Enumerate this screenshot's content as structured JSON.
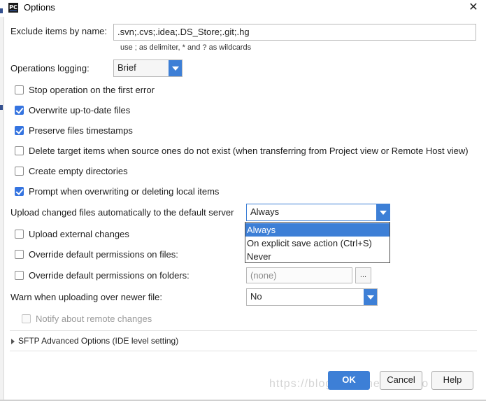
{
  "window": {
    "title": "Options",
    "app_icon_text": "PC"
  },
  "exclude": {
    "label": "Exclude items by name:",
    "value": ".svn;.cvs;.idea;.DS_Store;.git;.hg",
    "hint": "use ; as delimiter, * and ? as wildcards"
  },
  "logging": {
    "label": "Operations logging:",
    "value": "Brief"
  },
  "checkboxes": [
    {
      "label": "Stop operation on the first error",
      "checked": false
    },
    {
      "label": "Overwrite up-to-date files",
      "checked": true
    },
    {
      "label": "Preserve files timestamps",
      "checked": true
    },
    {
      "label": "Delete target items when source ones do not exist (when transferring from Project view or Remote Host view)",
      "checked": false
    },
    {
      "label": "Create empty directories",
      "checked": false
    },
    {
      "label": "Prompt when overwriting or deleting local items",
      "checked": true
    }
  ],
  "upload_auto": {
    "label": "Upload changed files automatically to the default server",
    "value": "Always",
    "options": [
      "Always",
      "On explicit save action (Ctrl+S)",
      "Never"
    ],
    "selected_option": "Always"
  },
  "upload_external": {
    "label": "Upload external changes",
    "checked": false
  },
  "override_files": {
    "label": "Override default permissions on files:",
    "checked": false
  },
  "override_folders": {
    "label": "Override default permissions on folders:",
    "checked": false,
    "value": "(none)",
    "browse_label": "..."
  },
  "warn_newer": {
    "label": "Warn when uploading over newer file:",
    "value": "No"
  },
  "notify_remote": {
    "label": "Notify about remote changes",
    "checked": false,
    "enabled": false
  },
  "sftp": {
    "label": "SFTP Advanced Options (IDE level setting)"
  },
  "buttons": {
    "ok": "OK",
    "cancel": "Cancel",
    "help": "Help"
  },
  "watermark": "https://blog.csdn.net/maihao"
}
